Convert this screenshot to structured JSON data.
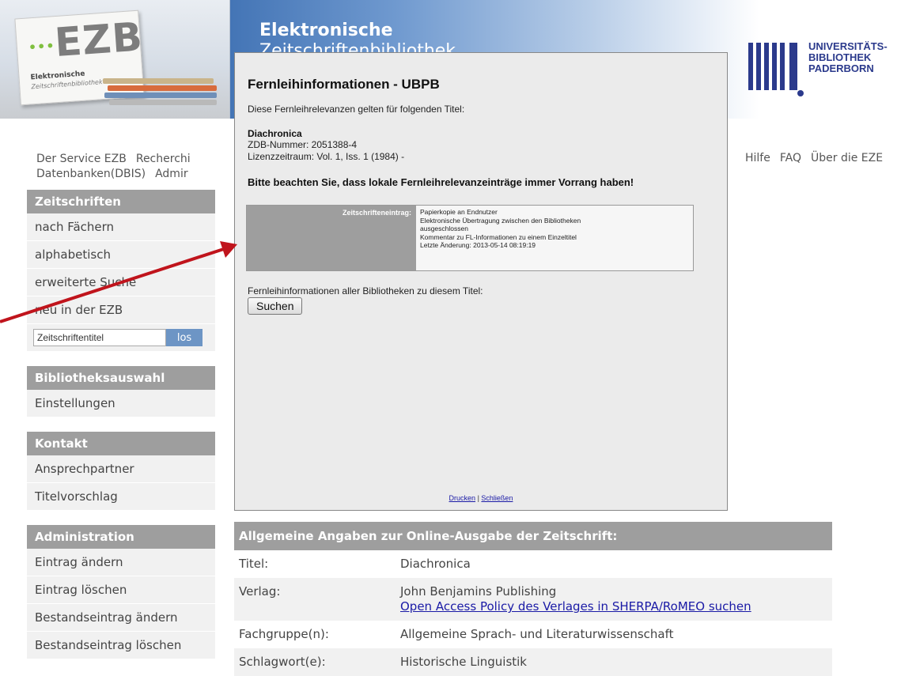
{
  "header": {
    "logo_text": "EZB",
    "logo_sub1": "Elektronische",
    "logo_sub2": "Zeitschriftenbibliothek",
    "title_line1": "Elektronische",
    "title_line2": "Zeitschriftenbibliothek",
    "ub_line1": "UNIVERSITÄTS-",
    "ub_line2": "BIBLIOTHEK",
    "ub_line3": "PADERBORN"
  },
  "topnav": {
    "items": [
      "Der Service EZB",
      "Recherchi"
    ],
    "row2": [
      "Datenbanken(DBIS)",
      "Admir"
    ],
    "right": [
      "Hilfe",
      "FAQ",
      "Über die EZE"
    ]
  },
  "sidebar": {
    "zeitschriften_head": "Zeitschriften",
    "zeitschriften_items": [
      "nach Fächern",
      "alphabetisch",
      "erweiterte Suche",
      "neu in der EZB"
    ],
    "search_value": "Zeitschriftentitel",
    "search_button": "los",
    "bib_head": "Bibliotheksauswahl",
    "bib_items": [
      "Einstellungen"
    ],
    "kontakt_head": "Kontakt",
    "kontakt_items": [
      "Ansprechpartner",
      "Titelvorschlag"
    ],
    "admin_head": "Administration",
    "admin_items": [
      "Eintrag ändern",
      "Eintrag löschen",
      "Bestandseintrag ändern",
      "Bestandseintrag löschen"
    ]
  },
  "modal": {
    "title": "Fernleihinformationen - UBPB",
    "subtitle": "Diese Fernleihrelevanzen gelten für folgenden Titel:",
    "journal_title": "Diachronica",
    "zdb": "ZDB-Nummer: 2051388-4",
    "license": "Lizenzzeitraum: Vol. 1, Iss. 1 (1984) -",
    "note": "Bitte beachten Sie, dass lokale Fernleihrelevanzeinträge immer Vorrang haben!",
    "entry_label": "Zeitschrifteneintrag:",
    "entry_lines": [
      "Papierkopie an Endnutzer",
      "Elektronische Übertragung zwischen den Bibliotheken",
      "ausgeschlossen",
      "Kommentar zu FL-Informationen zu einem Einzeltitel",
      "Letzte Änderung: 2013-05-14 08:19:19"
    ],
    "all_libraries": "Fernleihinformationen aller Bibliotheken zu diesem Titel:",
    "search_button": "Suchen",
    "print_link": "Drucken",
    "separator": "|",
    "close_link": "Schließen"
  },
  "info": {
    "head": "Allgemeine Angaben zur Online-Ausgabe der Zeitschrift:",
    "rows": [
      {
        "key": "Titel:",
        "value": "Diachronica"
      },
      {
        "key": "Verlag:",
        "value": "John Benjamins Publishing",
        "link": "Open Access Policy des Verlages in SHERPA/RoMEO suchen"
      },
      {
        "key": "Fachgruppe(n):",
        "value": "Allgemeine Sprach- und Literaturwissenschaft"
      },
      {
        "key": "Schlagwort(e):",
        "value": "Historische Linguistik"
      }
    ]
  },
  "colors": {
    "sidebar_head": "#9e9e9e",
    "header_blue": "#3f71b3",
    "arrow": "#c0141c",
    "ub_blue": "#2b3a8c"
  }
}
